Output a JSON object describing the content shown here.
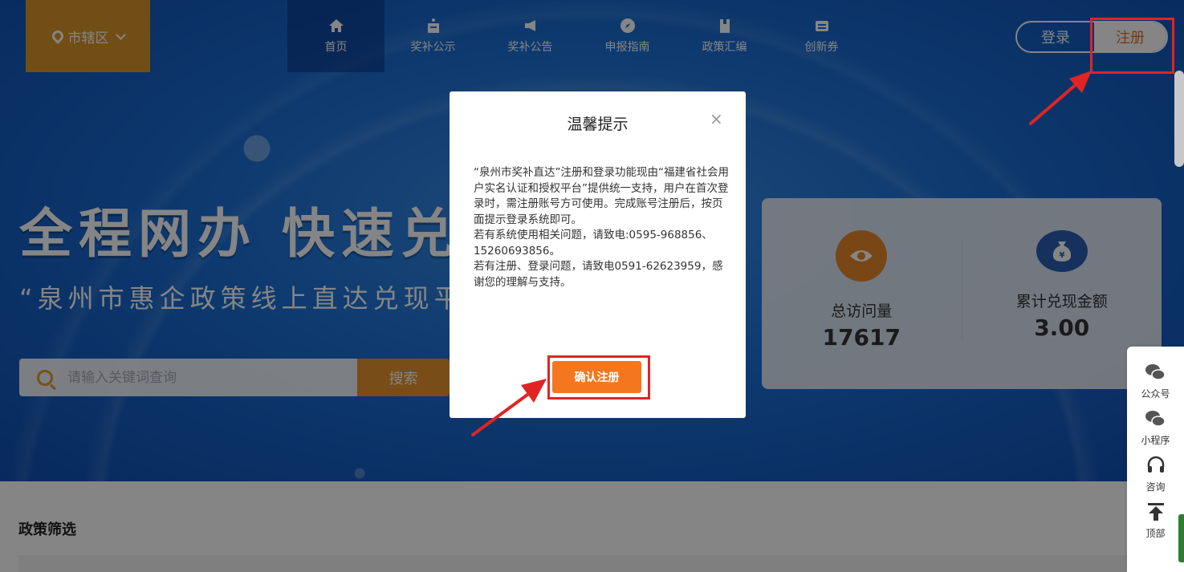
{
  "header": {
    "location": "市辖区",
    "nav": [
      {
        "label": "首页",
        "icon": "home-icon"
      },
      {
        "label": "奖补公示",
        "icon": "notice-icon"
      },
      {
        "label": "奖补公告",
        "icon": "megaphone-icon"
      },
      {
        "label": "申报指南",
        "icon": "compass-icon"
      },
      {
        "label": "政策汇编",
        "icon": "book-icon"
      },
      {
        "label": "创新券",
        "icon": "ticket-icon"
      }
    ],
    "login_label": "登录",
    "register_label": "注册"
  },
  "hero": {
    "slogan": "全程网办 快速兑现",
    "subtitle": "“泉州市惠企政策线上直达兑现平台”",
    "search_placeholder": "请输入关键词查询",
    "search_button": "搜索"
  },
  "stats": [
    {
      "label": "总访问量",
      "value": "17617",
      "icon": "eye-icon",
      "color": "#e8892b"
    },
    {
      "label": "累计兑现金额",
      "value": "3.00",
      "icon": "money-bag-icon",
      "color": "#2b5eb3"
    }
  ],
  "sidebar": [
    {
      "label": "公众号",
      "icon": "wechat-icon"
    },
    {
      "label": "小程序",
      "icon": "wechat-icon"
    },
    {
      "label": "咨询",
      "icon": "headset-icon"
    },
    {
      "label": "顶部",
      "icon": "arrow-up-icon"
    }
  ],
  "section": {
    "title": "政策筛选"
  },
  "modal": {
    "title": "温馨提示",
    "close": "×",
    "paragraph1": "“泉州市奖补直达”注册和登录功能现由“福建省社会用户实名认证和授权平台”提供统一支持，用户在首次登录时，需注册账号方可使用。完成账号注册后，按页面提示登录系统即可。",
    "paragraph2": "若有系统使用相关问题，请致电:0595-968856、15260693856。",
    "paragraph3": "若有注册、登录问题，请致电0591-62623959，感谢您的理解与支持。",
    "confirm_button": "确认注册"
  },
  "colors": {
    "accent": "#e6942c",
    "confirm": "#f4771f",
    "highlight": "#e02424",
    "brand_blue": "#1b6fd6"
  }
}
